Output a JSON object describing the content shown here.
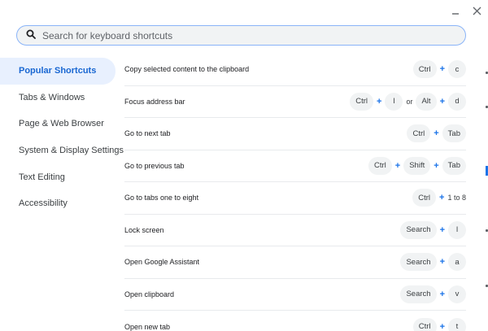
{
  "window": {
    "minimize_icon": "minimize-icon",
    "close_icon": "close-icon"
  },
  "search": {
    "placeholder": "Search for keyboard shortcuts",
    "icon": "search-icon"
  },
  "sidebar": {
    "items": [
      {
        "label": "Popular Shortcuts",
        "active": true
      },
      {
        "label": "Tabs & Windows",
        "active": false
      },
      {
        "label": "Page & Web Browser",
        "active": false
      },
      {
        "label": "System & Display Settings",
        "active": false
      },
      {
        "label": "Text Editing",
        "active": false
      },
      {
        "label": "Accessibility",
        "active": false
      }
    ]
  },
  "shortcuts": [
    {
      "description": "Copy selected content to the clipboard",
      "keys": [
        "Ctrl",
        "+",
        "c"
      ]
    },
    {
      "description": "Focus address bar",
      "keys": [
        "Ctrl",
        "+",
        "l",
        "or",
        "Alt",
        "+",
        "d"
      ]
    },
    {
      "description": "Go to next tab",
      "keys": [
        "Ctrl",
        "+",
        "Tab"
      ]
    },
    {
      "description": "Go to previous tab",
      "keys": [
        "Ctrl",
        "+",
        "Shift",
        "+",
        "Tab"
      ]
    },
    {
      "description": "Go to tabs one to eight",
      "keys": [
        "Ctrl",
        "+",
        "1 to 8"
      ]
    },
    {
      "description": "Lock screen",
      "keys": [
        "Search",
        "+",
        "l"
      ]
    },
    {
      "description": "Open Google Assistant",
      "keys": [
        "Search",
        "+",
        "a"
      ]
    },
    {
      "description": "Open clipboard",
      "keys": [
        "Search",
        "+",
        "v"
      ]
    },
    {
      "description": "Open new tab",
      "keys": [
        "Ctrl",
        "+",
        "t"
      ]
    }
  ],
  "colors": {
    "accent": "#1a73e8",
    "active_bg": "#e8f0fe",
    "active_text": "#1967d2",
    "key_bg": "#f1f3f4"
  }
}
